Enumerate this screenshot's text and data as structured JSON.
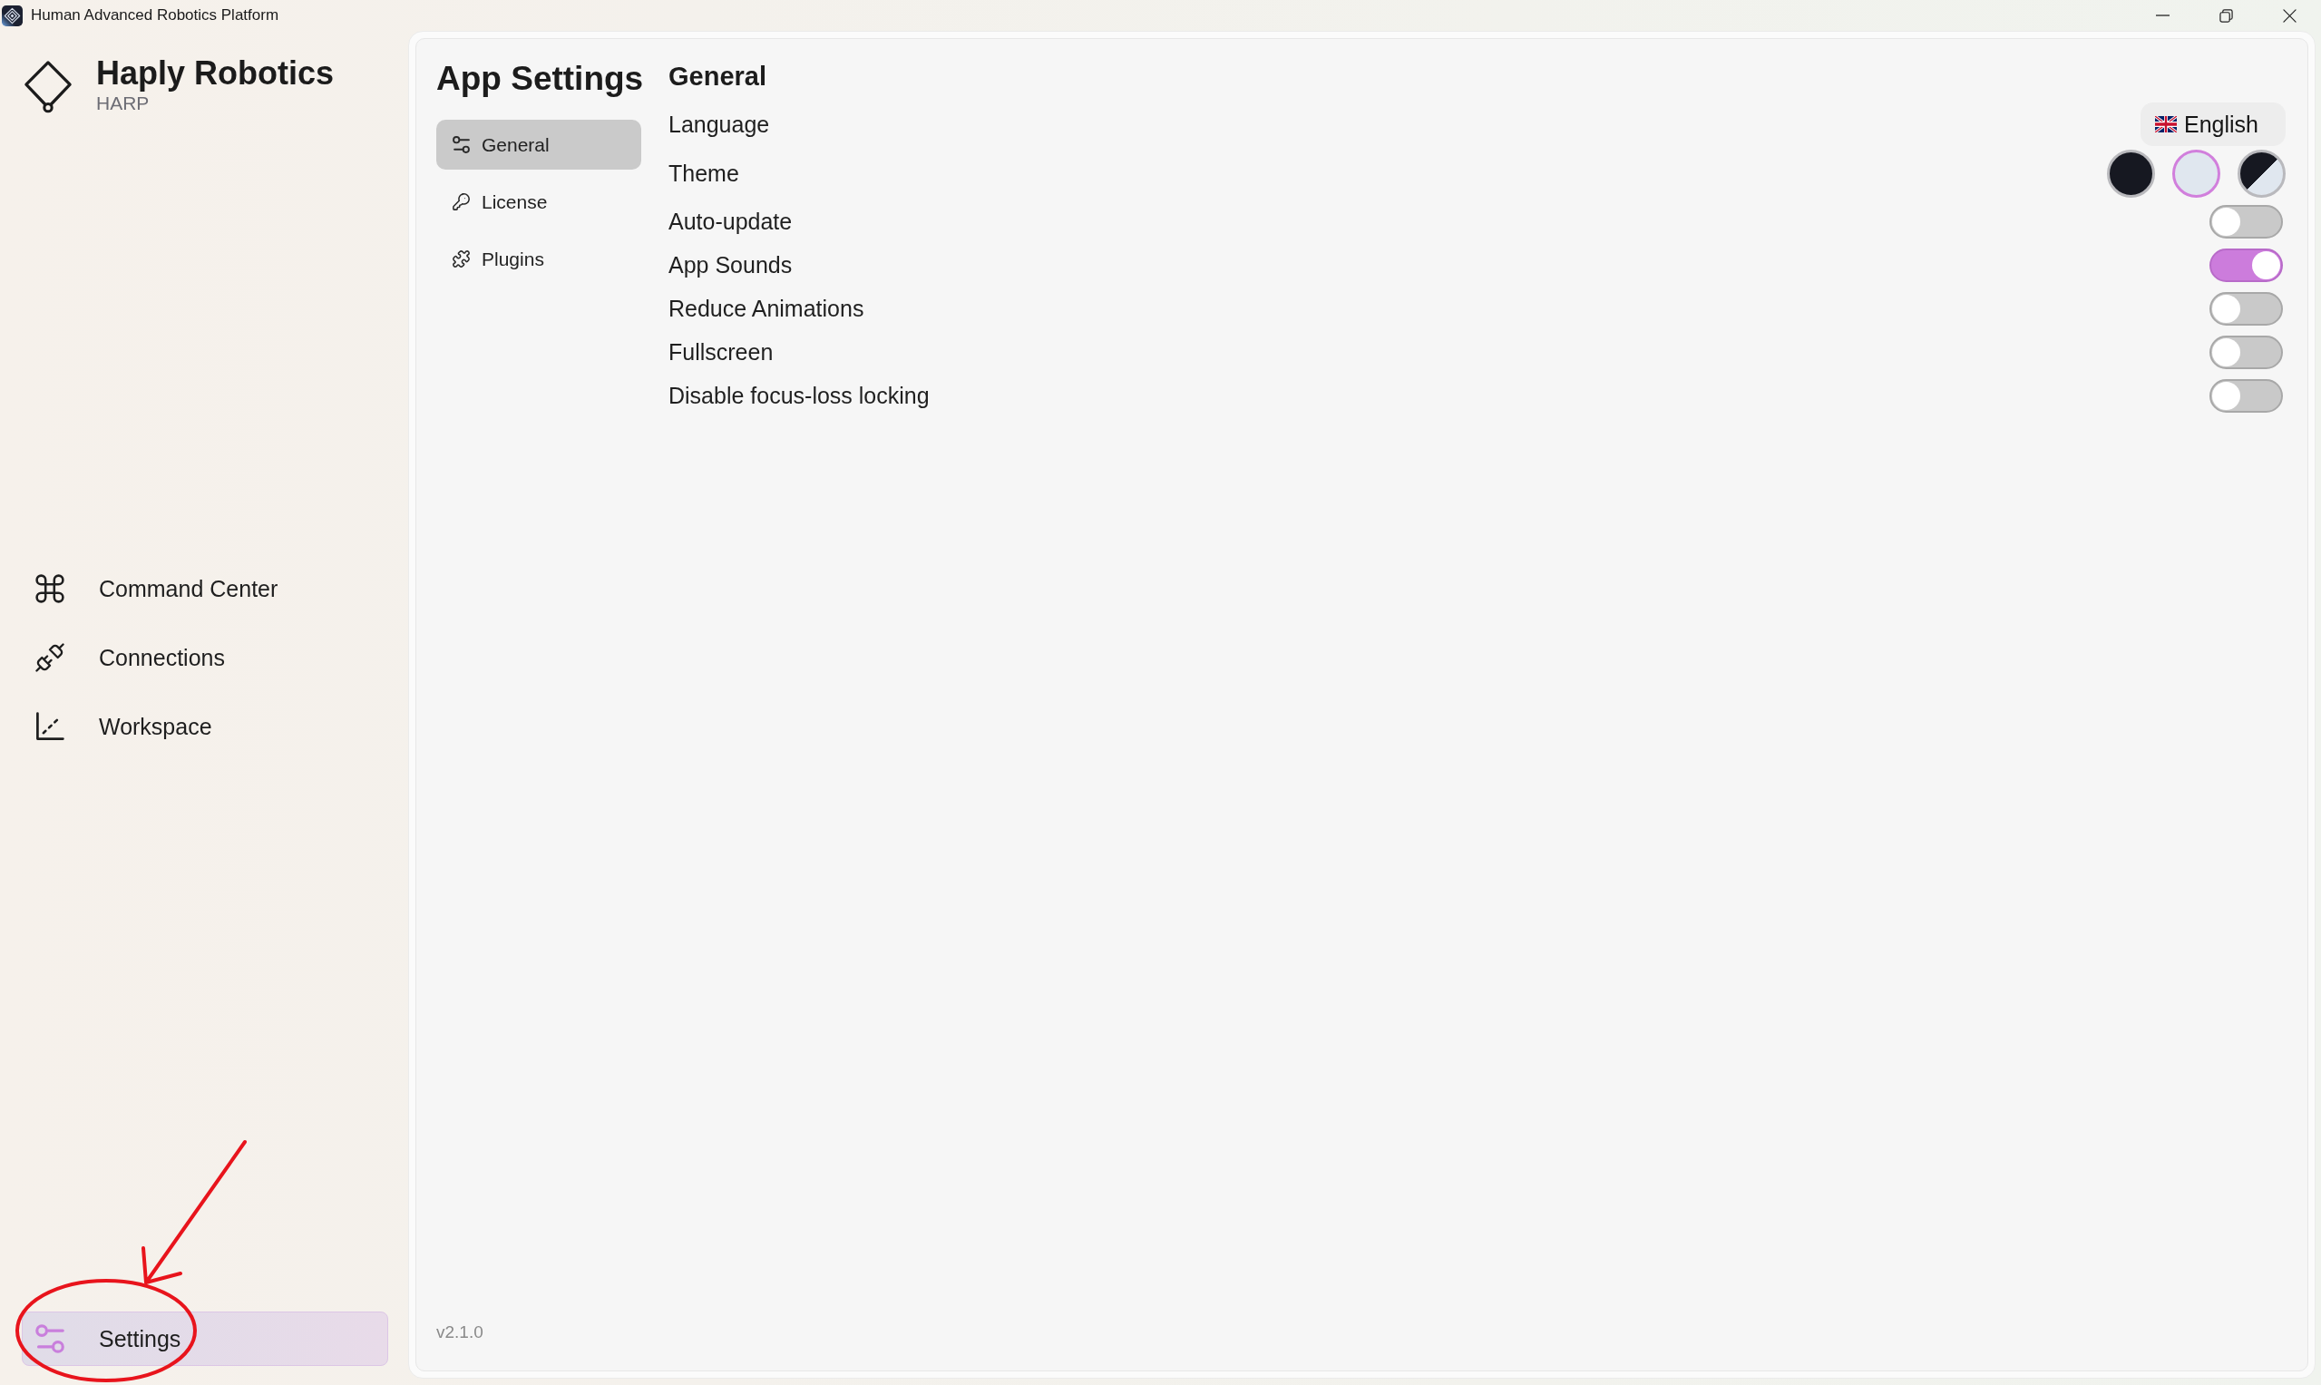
{
  "window": {
    "title": "Human Advanced Robotics Platform"
  },
  "sidebar": {
    "brand": "Haply Robotics",
    "subtitle": "HARP",
    "items": [
      {
        "label": "Command Center",
        "selected": false
      },
      {
        "label": "Connections",
        "selected": false
      },
      {
        "label": "Workspace",
        "selected": false
      }
    ],
    "bottom_item": {
      "label": "Settings",
      "selected": true
    }
  },
  "settings": {
    "title": "App Settings",
    "nav": [
      {
        "label": "General",
        "selected": true
      },
      {
        "label": "License",
        "selected": false
      },
      {
        "label": "Plugins",
        "selected": false
      }
    ],
    "version": "v2.1.0"
  },
  "section": {
    "title": "General",
    "rows": [
      {
        "label": "Language",
        "kind": "select",
        "value": "English"
      },
      {
        "label": "Theme",
        "kind": "theme",
        "options": [
          {
            "kind": "dark",
            "selected": false
          },
          {
            "kind": "light",
            "selected": true
          },
          {
            "kind": "system",
            "selected": false
          }
        ]
      },
      {
        "label": "Auto-update",
        "kind": "toggle",
        "on": false
      },
      {
        "label": "App Sounds",
        "kind": "toggle",
        "on": true
      },
      {
        "label": "Reduce Animations",
        "kind": "toggle",
        "on": false
      },
      {
        "label": "Fullscreen",
        "kind": "toggle",
        "on": false
      },
      {
        "label": "Disable focus-loss locking",
        "kind": "toggle",
        "on": false
      }
    ]
  }
}
